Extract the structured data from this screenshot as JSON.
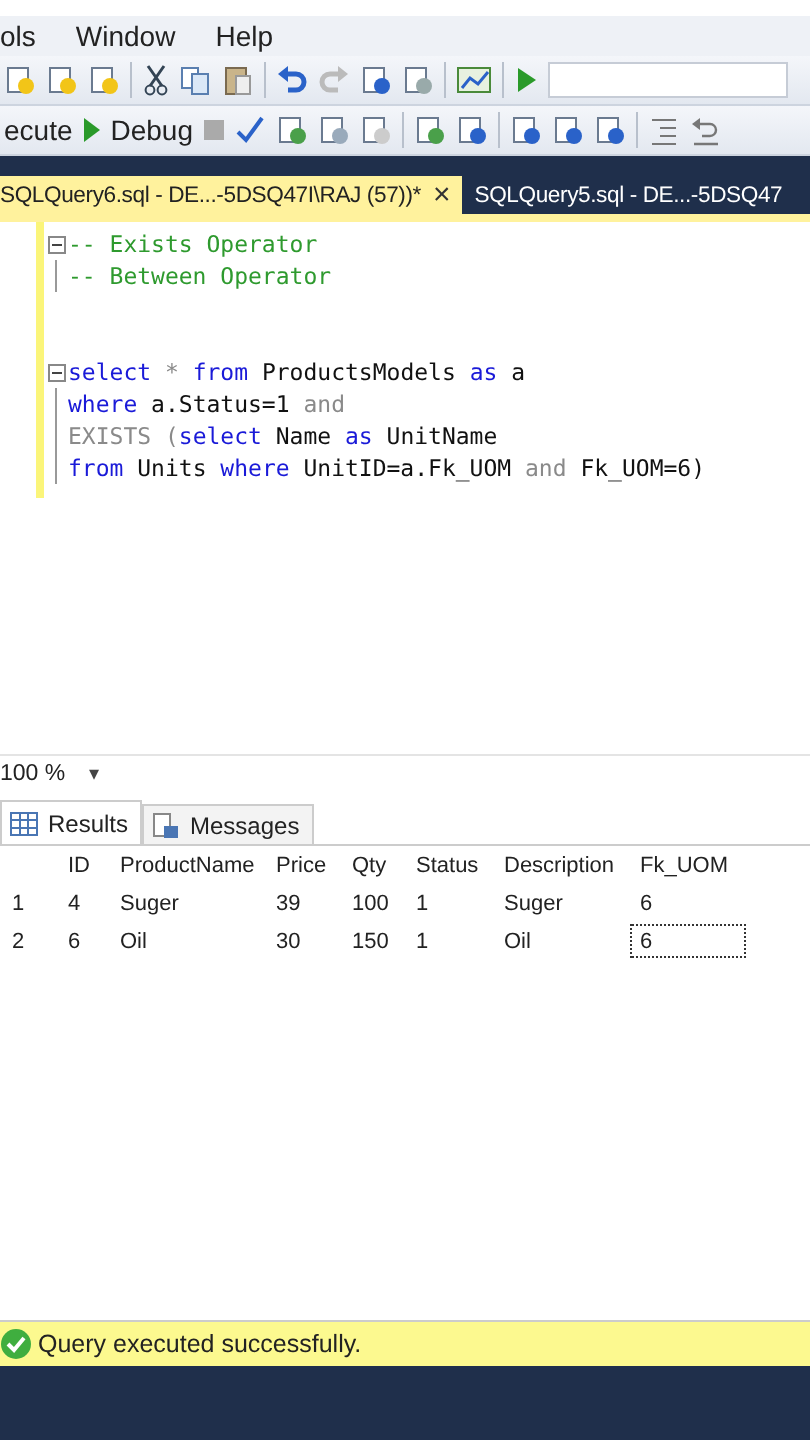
{
  "menu": [
    "ols",
    "Window",
    "Help"
  ],
  "toolbar": {
    "execute": "ecute",
    "debug": "Debug"
  },
  "tabs": [
    {
      "label": "SQLQuery6.sql - DE...-5DSQ47I\\RAJ (57))*",
      "close": "×",
      "selected": true
    },
    {
      "label": "SQLQuery5.sql - DE...-5DSQ47",
      "selected": false
    }
  ],
  "editor": {
    "lines": [
      {
        "fold": true,
        "tokens": [
          {
            "kind": "comment",
            "text": "-- Exists Operator"
          }
        ]
      },
      {
        "fold": false,
        "tokens": [
          {
            "kind": "comment",
            "text": "-- Between Operator"
          }
        ]
      },
      {
        "kind": "blank"
      },
      {
        "kind": "blank"
      },
      {
        "fold": true,
        "tokens": [
          {
            "kind": "keyword",
            "text": "select"
          },
          {
            "kind": "operator",
            "text": " * "
          },
          {
            "kind": "keyword",
            "text": "from"
          },
          {
            "kind": "plain",
            "text": " ProductsModels "
          },
          {
            "kind": "keyword",
            "text": "as"
          },
          {
            "kind": "plain",
            "text": " a"
          }
        ]
      },
      {
        "fold": false,
        "tokens": [
          {
            "kind": "keyword",
            "text": "where"
          },
          {
            "kind": "plain",
            "text": " a.Status=1"
          },
          {
            "kind": "operator",
            "text": " and"
          }
        ]
      },
      {
        "fold": false,
        "tokens": [
          {
            "kind": "operator",
            "text": "EXISTS ("
          },
          {
            "kind": "keyword",
            "text": "select"
          },
          {
            "kind": "plain",
            "text": " Name "
          },
          {
            "kind": "keyword",
            "text": "as"
          },
          {
            "kind": "plain",
            "text": " UnitName"
          }
        ]
      },
      {
        "fold": false,
        "tokens": [
          {
            "kind": "keyword",
            "text": "from"
          },
          {
            "kind": "plain",
            "text": " Units "
          },
          {
            "kind": "keyword",
            "text": "where"
          },
          {
            "kind": "plain",
            "text": " UnitID=a.Fk_UOM "
          },
          {
            "kind": "operator",
            "text": "and"
          },
          {
            "kind": "plain",
            "text": " Fk_UOM=6)"
          }
        ]
      }
    ]
  },
  "zoom": {
    "value": "100 %",
    "arrow": "▾"
  },
  "result_tabs": [
    {
      "label": "Results",
      "selected": true
    },
    {
      "label": "Messages",
      "selected": false
    }
  ],
  "grid": {
    "columns": [
      "ID",
      "ProductName",
      "Price",
      "Qty",
      "Status",
      "Description",
      "Fk_UOM"
    ],
    "rows": [
      {
        "number": "1",
        "cells": [
          {
            "text": "4",
            "selected": false
          },
          {
            "text": "Suger",
            "selected": false
          },
          {
            "text": "39",
            "selected": false
          },
          {
            "text": "100",
            "selected": false
          },
          {
            "text": "1",
            "selected": false
          },
          {
            "text": "Suger",
            "selected": false
          },
          {
            "text": "6",
            "selected": false
          }
        ]
      },
      {
        "number": "2",
        "cells": [
          {
            "text": "6",
            "selected": false
          },
          {
            "text": "Oil",
            "selected": false
          },
          {
            "text": "30",
            "selected": false
          },
          {
            "text": "150",
            "selected": false
          },
          {
            "text": "1",
            "selected": false
          },
          {
            "text": "Oil",
            "selected": false
          },
          {
            "text": "6",
            "selected": true
          }
        ]
      }
    ]
  },
  "status_bar": {
    "message": "Query executed successfully."
  }
}
